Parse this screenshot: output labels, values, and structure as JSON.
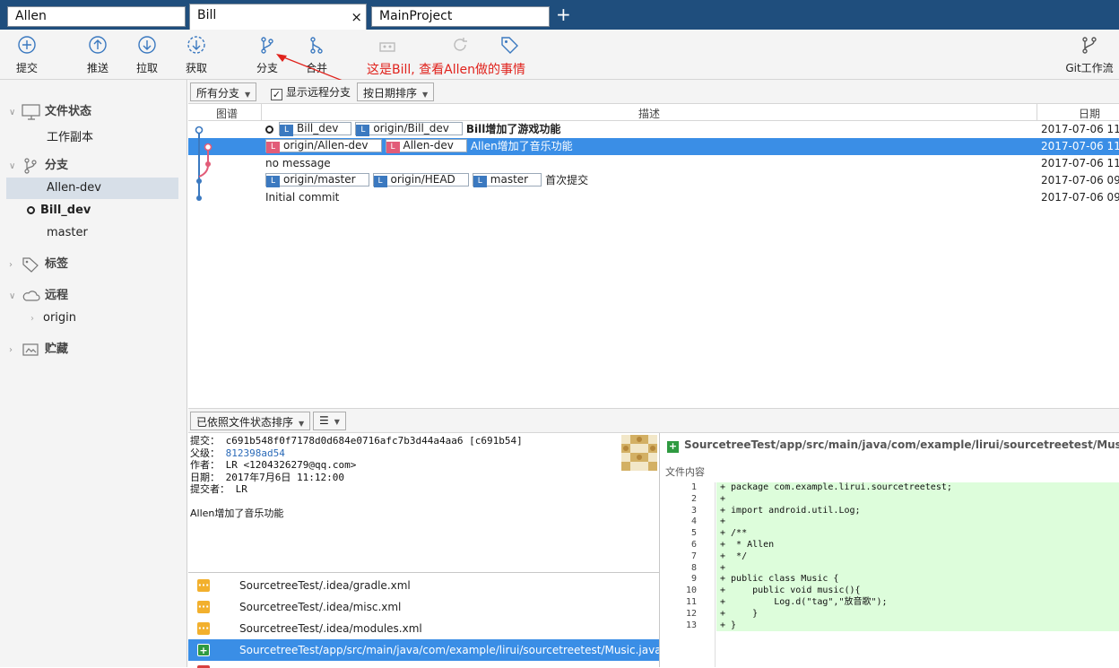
{
  "tabs": [
    {
      "label": "Allen"
    },
    {
      "label": "Bill",
      "close": "×"
    },
    {
      "label": "MainProject"
    }
  ],
  "add_tab": "+",
  "toolbar": {
    "commit": "提交",
    "push": "推送",
    "pull": "拉取",
    "fetch": "获取",
    "branch": "分支",
    "merge": "合并",
    "gitflow": "Git工作流"
  },
  "annotation": "这是Bill, 查看Allen做的事情",
  "sidebar": {
    "file_status": "文件状态",
    "working_copy": "工作副本",
    "branches": "分支",
    "branch_items": [
      "Allen-dev",
      "Bill_dev",
      "master"
    ],
    "tags": "标签",
    "remotes": "远程",
    "remote_items": [
      "origin"
    ],
    "stashes": "贮藏"
  },
  "filter": {
    "all_branches": "所有分支",
    "show_remote": "显示远程分支",
    "sort_date": "按日期排序"
  },
  "columns": {
    "graph": "图谱",
    "description": "描述",
    "date": "日期"
  },
  "commits": [
    {
      "refs": [
        "Bill_dev",
        "origin/Bill_dev"
      ],
      "message": "Bill增加了游戏功能",
      "date": "2017-07-06 11:"
    },
    {
      "refs": [
        "origin/Allen-dev",
        "Allen-dev"
      ],
      "message": "Allen增加了音乐功能",
      "date": "2017-07-06 11:"
    },
    {
      "refs": [],
      "message": "no message",
      "date": "2017-07-06 11:"
    },
    {
      "refs": [
        "origin/master",
        "origin/HEAD",
        "master"
      ],
      "message": "首次提交",
      "date": "2017-07-06 09:"
    },
    {
      "refs": [],
      "message": "Initial commit",
      "date": "2017-07-06 09:"
    }
  ],
  "midbar": {
    "sort": "已依照文件状态排序",
    "view": "☰"
  },
  "details": {
    "commit_label": "提交：",
    "commit_value": "c691b548f0f7178d0d684e0716afc7b3d44a4aa6 [c691b54]",
    "parent_label": "父级：",
    "parent_value": "812398ad54",
    "author_label": "作者：",
    "author_value": "LR <1204326279@qq.com>",
    "date_label": "日期：",
    "date_value": "2017年7月6日 11:12:00",
    "committer_label": "提交者：",
    "committer_value": "LR",
    "message": "Allen增加了音乐功能"
  },
  "files": [
    {
      "name": "SourcetreeTest/.idea/gradle.xml",
      "status": "modified"
    },
    {
      "name": "SourcetreeTest/.idea/misc.xml",
      "status": "modified"
    },
    {
      "name": "SourcetreeTest/.idea/modules.xml",
      "status": "modified"
    },
    {
      "name": "SourcetreeTest/app/src/main/java/com/example/lirui/sourcetreetest/Music.java",
      "status": "added"
    }
  ],
  "diff": {
    "file_path": "SourcetreeTest/app/src/main/java/com/example/lirui/sourcetreetest/Music.java",
    "content_label": "文件内容",
    "lines": [
      "+ package com.example.lirui.sourcetreetest;",
      "+",
      "+ import android.util.Log;",
      "+",
      "+ /**",
      "+  * Allen",
      "+  */",
      "+",
      "+ public class Music {",
      "+     public void music(){",
      "+         Log.d(\"tag\",\"放音歌\");",
      "+     }",
      "+ }"
    ]
  },
  "colors": {
    "accent": "#3a8ee6",
    "tabbar": "#1f4e7d",
    "annotation": "#e0221c",
    "added": "#ddfddb"
  }
}
